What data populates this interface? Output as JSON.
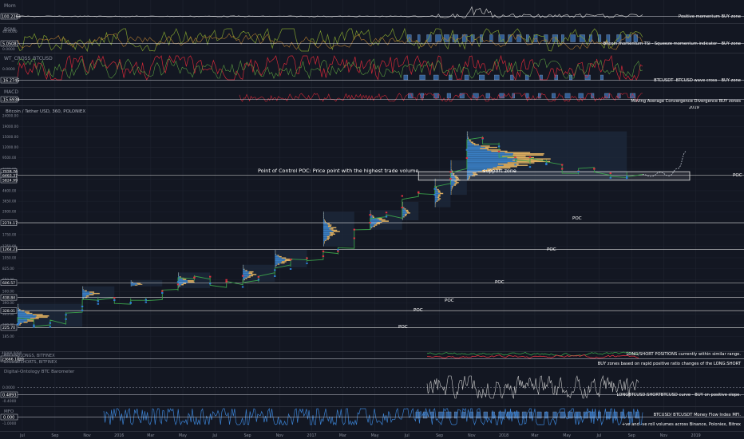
{
  "theme": {
    "background": "#131722",
    "grid": "#1f2430",
    "separator": "#2a2e39",
    "text": "#d1d4dc",
    "muted": "#8a8f9c",
    "green": "#26a641",
    "red": "#e03040",
    "blue": "#2d7dd2",
    "volume_blue": "#3a7fc4",
    "volume_orange": "#e0b060",
    "white_line": "#c8c8c8"
  },
  "time_axis": {
    "labels": [
      "Jul",
      "Sep",
      "Nov",
      "2016",
      "Mar",
      "May",
      "Jul",
      "Sep",
      "Nov",
      "2017",
      "Mar",
      "May",
      "Jul",
      "Sep",
      "Nov",
      "2018",
      "Mar",
      "May",
      "Jul",
      "Sep",
      "Nov",
      "2019"
    ]
  },
  "panels": {
    "mom": {
      "title": "Mom",
      "price_tag": "100.2263",
      "annotation": "Positive momentum BUY zone",
      "color": "#c8c8c8"
    },
    "bsmi": {
      "title": "BSMI",
      "scale": [
        "40.0000",
        "0.0000"
      ],
      "price_tag": "5.0508",
      "annotation": "Bitcoin momentum TSI - Squeeze momentum indicator - BUY zone"
    },
    "wt": {
      "title": "WT_CROSS_BTCUSD",
      "scale": [
        "0.0000"
      ],
      "price_tag": "-16.2745",
      "annotation": "BTCUSDT -BTCUSD wave cross - BUY zone"
    },
    "macd": {
      "title": "MACD",
      "price_tag": "-15.6934",
      "annotation": "Moving Average Convergence Divergence BUY zones",
      "extra_label": "2019"
    },
    "main": {
      "title": "Bitcoin / Tether USD, 360, POLONIEX",
      "y_ticks": [
        "24000.00",
        "19000.00",
        "15000.00",
        "12000.00",
        "9500.00",
        "7400.00",
        "5900.00",
        "4600.00",
        "3650.00",
        "2900.00",
        "2300.00",
        "1750.00",
        "1350.00",
        "1050.00",
        "825.00",
        "650.00",
        "500.00",
        "390.00",
        "305.00",
        "240.00",
        "185.00"
      ],
      "price_tags": [
        "7028.76",
        "6463.37",
        "5824.99",
        "2274.17",
        "1264.21",
        "606.57",
        "438.84",
        "328.01",
        "225.70"
      ],
      "poc_annotation": "Point of Control POC: Price point with the highest trade volume",
      "support_label": "support zone",
      "poc_labels": [
        "POC",
        "POC",
        "POC",
        "POC",
        "POC",
        "POC",
        "POC"
      ]
    },
    "longshort": {
      "title1": "BTCUSDLONGS, BITFINEX",
      "title2": "BTCUSDSHORTS, BITFINEX",
      "scale": [
        "40000.0000"
      ],
      "price_tag": "23666.1020",
      "annotation1": "LONG/SHORT POSITIONS currently within similar range.",
      "annotation2": "BUY zones based on rapid positive ratio changes of the LONG:SHORT"
    },
    "barometer": {
      "title": "Digital-Ontology BTC Barometer",
      "scale": [
        "0.0000",
        "-0.4000"
      ],
      "price_tag": "0.4893",
      "annotation": "LONGBTCUSD:SHORTBTCUSD curve - BUY on positive slope."
    },
    "mfi": {
      "title": "MFO",
      "scale": [
        "0.0000",
        "-1.0000"
      ],
      "price_tag": "0.000",
      "annotation1": "BTCUSD/ BTCUSDT Money Flow Index MFI.",
      "annotation2": "+ve and -ve roll volumes across Binance, Poloniex, Bitrex"
    }
  },
  "chart_data": {
    "type": "line",
    "title": "Bitcoin / Tether USD, 360, POLONIEX",
    "xlabel": "",
    "ylabel": "",
    "y_scale": "log",
    "ylim": [
      160,
      24000
    ],
    "x": [
      "2015-07",
      "2015-08",
      "2015-09",
      "2015-10",
      "2015-11",
      "2015-12",
      "2016-01",
      "2016-02",
      "2016-03",
      "2016-04",
      "2016-05",
      "2016-06",
      "2016-07",
      "2016-08",
      "2016-09",
      "2016-10",
      "2016-11",
      "2016-12",
      "2017-01",
      "2017-02",
      "2017-03",
      "2017-04",
      "2017-05",
      "2017-06",
      "2017-07",
      "2017-08",
      "2017-09",
      "2017-10",
      "2017-11",
      "2017-12",
      "2018-01",
      "2018-02",
      "2018-03",
      "2018-04",
      "2018-05",
      "2018-06",
      "2018-07",
      "2018-08",
      "2018-09",
      "2018-10"
    ],
    "series": [
      {
        "values": [
          285,
          265,
          235,
          255,
          330,
          420,
          430,
          400,
          415,
          430,
          520,
          680,
          660,
          580,
          605,
          640,
          730,
          900,
          980,
          1050,
          1150,
          1300,
          1950,
          2550,
          2650,
          4200,
          4400,
          5200,
          7500,
          15000,
          13500,
          9500,
          8500,
          9000,
          8400,
          6700,
          7600,
          6500,
          6500,
          6600
        ]
      }
    ],
    "projection": [
      6600,
      6300,
      6900,
      6400,
      7500,
      11000
    ],
    "support_zone": [
      5800,
      7000
    ],
    "poc_levels": [
      6463,
      2274,
      1264,
      606,
      439,
      328,
      226
    ],
    "grid": true
  }
}
